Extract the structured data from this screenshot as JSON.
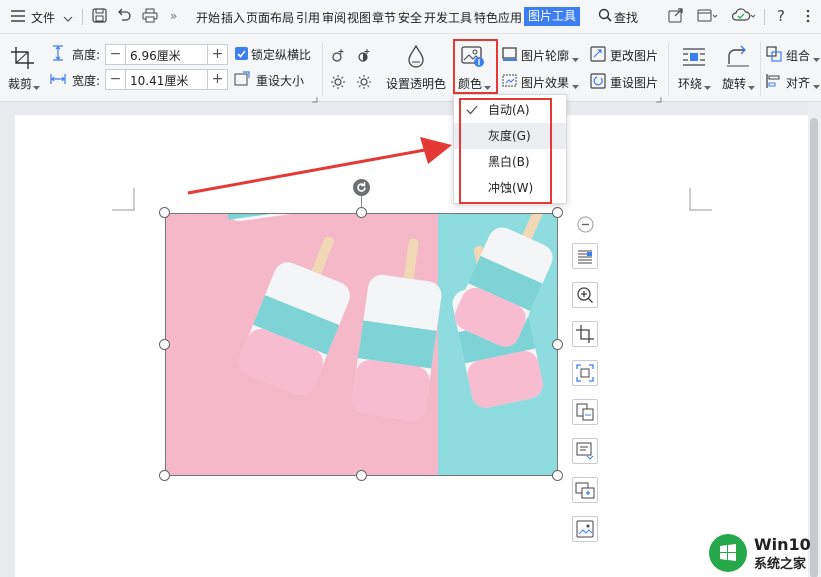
{
  "menu_bar": {
    "file_label": "文件",
    "tabs": [
      "开始",
      "插入",
      "页面布局",
      "引用",
      "审阅",
      "视图",
      "章节",
      "安全",
      "开发工具",
      "特色应用"
    ],
    "active_tab": "图片工具",
    "search_label": "查找"
  },
  "ribbon": {
    "crop_label": "裁剪",
    "height_label": "高度:",
    "height_value": "6.96厘米",
    "width_label": "宽度:",
    "width_value": "10.41厘米",
    "lock_ratio_label": "锁定纵横比",
    "lock_ratio_checked": true,
    "reset_size_label": "重设大小",
    "transparent_label": "设置透明色",
    "color_label": "颜色",
    "outline_label": "图片轮廓",
    "effect_label": "图片效果",
    "change_pic_label": "更改图片",
    "reset_pic_label": "重设图片",
    "wrap_label": "环绕",
    "rotate_label": "旋转",
    "group_label": "组合",
    "align_label": "对齐"
  },
  "color_menu": {
    "items": [
      "自动(A)",
      "灰度(G)",
      "黑白(B)",
      "冲蚀(W)"
    ],
    "checked_index": 0,
    "hovered_index": 1
  },
  "watermark": {
    "brand": "Win10",
    "site": "系统之家"
  },
  "colors": {
    "accent": "#3d7ef0",
    "annotation_red": "#e53935",
    "pink_bg": "#f4b8c8",
    "cyan_bg": "#8fdce0",
    "watermark_green": "#27a84a"
  }
}
